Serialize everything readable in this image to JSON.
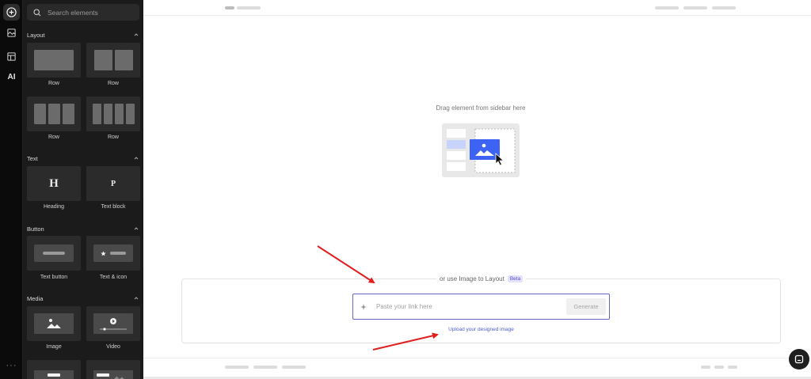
{
  "rail": {
    "items": [
      {
        "name": "add-icon",
        "active": true
      },
      {
        "name": "layers-icon",
        "active": false
      },
      {
        "name": "layout-icon",
        "active": false
      },
      {
        "name": "ai-icon",
        "label": "AI",
        "active": false
      }
    ],
    "more_label": "···"
  },
  "sidebar": {
    "search": {
      "placeholder": "Search elements",
      "value": ""
    },
    "sections": {
      "layout": {
        "title": "Layout",
        "items": [
          "Row",
          "Row",
          "Row",
          "Row"
        ]
      },
      "text": {
        "title": "Text",
        "items": [
          "Heading",
          "Text block"
        ],
        "glyphs": [
          "H",
          "P"
        ]
      },
      "button": {
        "title": "Button",
        "items": [
          "Text button",
          "Text & icon"
        ]
      },
      "media": {
        "title": "Media",
        "items": [
          "Image",
          "Video"
        ]
      }
    }
  },
  "canvas": {
    "drag_hint": "Drag element from sidebar here",
    "image_to_layout": {
      "title": "or use Image to Layout",
      "badge": "Beta",
      "input_placeholder": "Paste your link here",
      "input_value": "",
      "generate_label": "Generate",
      "upload_link": "Upload your designed image"
    },
    "annotation_color": "#e02020",
    "accent": "#3d63f5"
  }
}
